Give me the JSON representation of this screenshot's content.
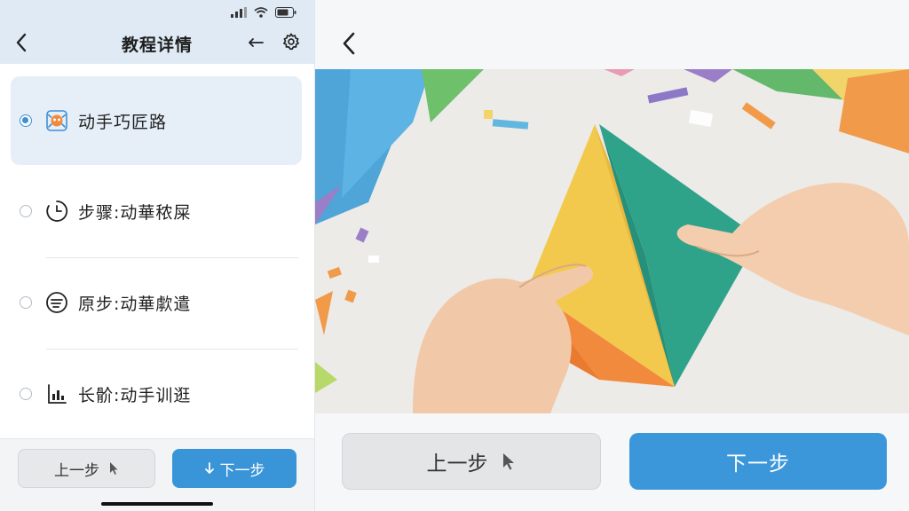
{
  "header": {
    "title": "教程详情"
  },
  "steps": [
    {
      "label": "动手巧匠路",
      "icon": "craft-robot-icon",
      "selected": true
    },
    {
      "label": "步骤:动華秾屎",
      "icon": "clock-icon",
      "selected": false
    },
    {
      "label": "原步:动華歑遣",
      "icon": "list-circle-icon",
      "selected": false
    },
    {
      "label": "长骱:动手训逛",
      "icon": "chart-icon",
      "selected": false
    }
  ],
  "buttons": {
    "prev_label": "上一步",
    "next_label": "下一步"
  },
  "image": {
    "subject": "origami-folding-photo"
  },
  "colors": {
    "accent": "#3a94d8",
    "header_bg": "#dfeaf5",
    "selected_bg": "#e6eff8"
  }
}
